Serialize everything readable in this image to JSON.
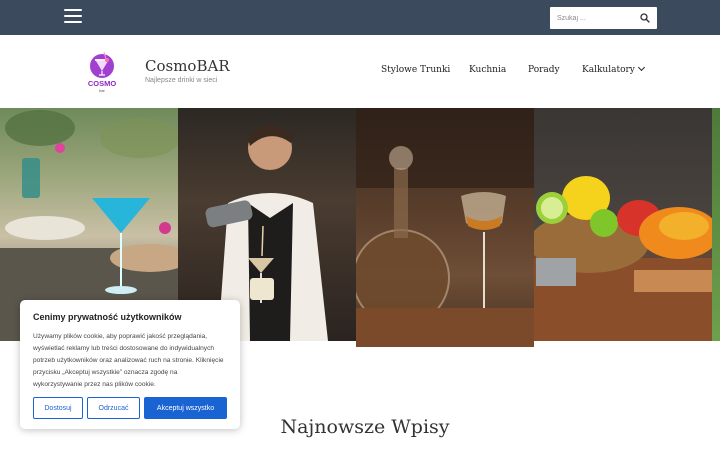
{
  "topbar": {
    "menu_icon": "hamburger-menu-icon",
    "search": {
      "placeholder": "Szukaj ...",
      "icon": "search-icon"
    }
  },
  "header": {
    "logo": {
      "text": "COSMO",
      "subtext": "bar",
      "icon": "cosmo-cocktail-logo"
    },
    "site_title": "CosmoBAR",
    "tagline": "Najlepsze drinki w sieci",
    "nav": [
      {
        "label": "Stylowe Trunki"
      },
      {
        "label": "Kuchnia"
      },
      {
        "label": "Porady"
      },
      {
        "label": "Kalkulatory",
        "icon": "chevron-down-icon"
      }
    ]
  },
  "hero": {
    "panels": [
      "blue-cocktail-photo",
      "bartender-shaker-photo",
      "whisky-glass-decanter-photo",
      "citrus-fruits-photo",
      "green-photo-edge"
    ]
  },
  "main": {
    "section_title": "Najnowsze Wpisy"
  },
  "cookie_banner": {
    "title": "Cenimy prywatność użytkowników",
    "text": "Używamy plików cookie, aby poprawić jakość przeglądania, wyświetlać reklamy lub treści dostosowane do indywidualnych potrzeb użytkowników oraz analizować ruch na stronie. Kliknięcie przycisku „Akceptuj wszystkie” oznacza zgodę na wykorzystywanie przez nas plików cookie.",
    "buttons": {
      "customize": "Dostosuj",
      "reject": "Odrzucać",
      "accept_all": "Akceptuj wszystko"
    },
    "colors": {
      "primary": "#1a63d3"
    }
  },
  "colors": {
    "topbar": "#3b4a5c"
  }
}
